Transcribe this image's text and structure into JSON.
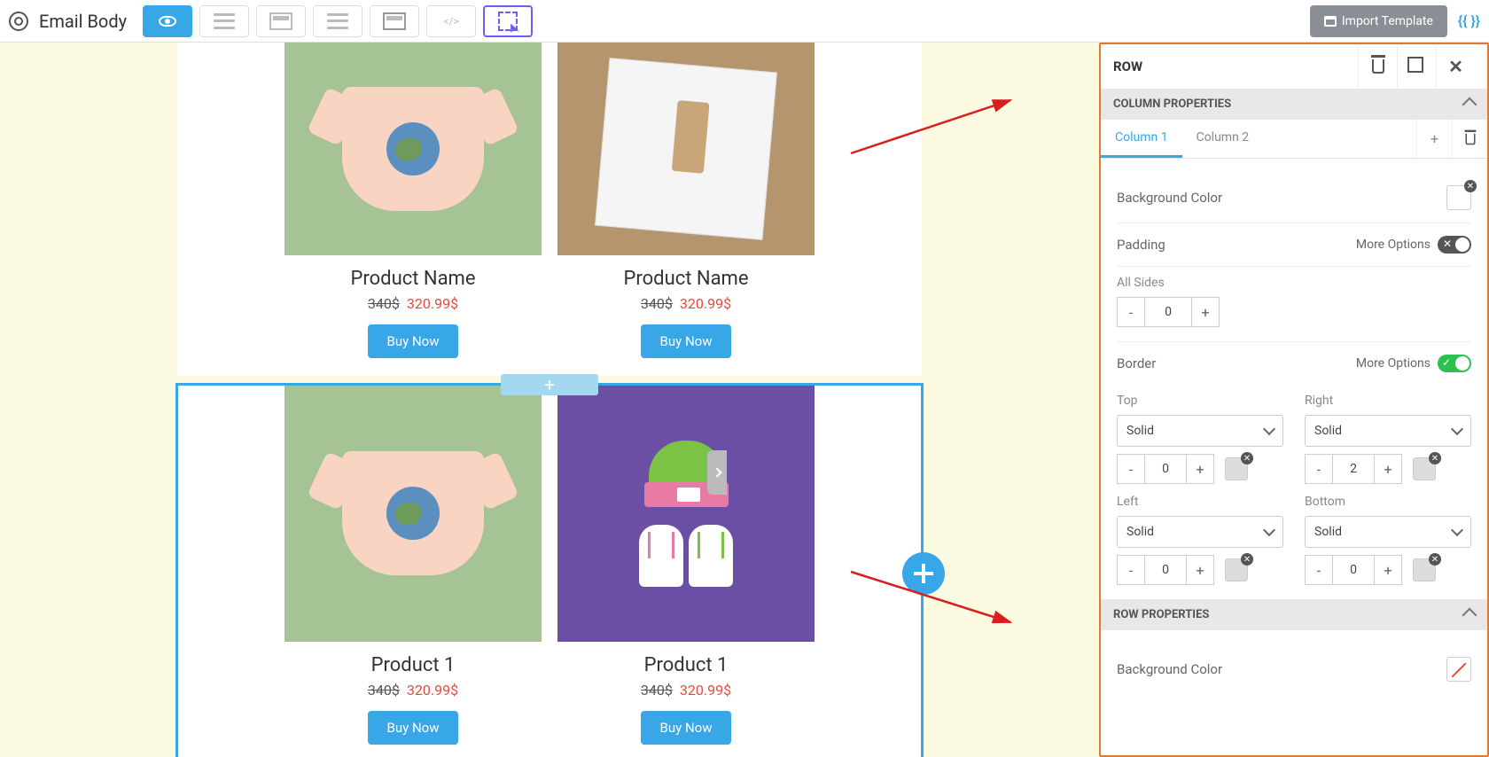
{
  "toolbar": {
    "title": "Email Body",
    "import_label": "Import Template",
    "braces": "{{ }}"
  },
  "products_top": [
    {
      "name": "Product Name",
      "old": "340$",
      "new": "320.99$",
      "buy": "Buy Now",
      "img": "green"
    },
    {
      "name": "Product Name",
      "old": "340$",
      "new": "320.99$",
      "buy": "Buy Now",
      "img": "brown"
    }
  ],
  "products_sel": [
    {
      "name": "Product 1",
      "old": "340$",
      "new": "320.99$",
      "buy": "Buy Now",
      "img": "green"
    },
    {
      "name": "Product 1",
      "old": "340$",
      "new": "320.99$",
      "buy": "Buy Now",
      "img": "purple"
    }
  ],
  "add_label": "+",
  "panel": {
    "title": "ROW",
    "col_props": "COLUMN PROPERTIES",
    "tabs": [
      "Column 1",
      "Column 2"
    ],
    "bg_color": "Background Color",
    "padding": "Padding",
    "more_opt": "More Options",
    "all_sides": "All Sides",
    "all_sides_val": "0",
    "border": "Border",
    "borders": {
      "top": {
        "label": "Top",
        "style": "Solid",
        "val": "0"
      },
      "right": {
        "label": "Right",
        "style": "Solid",
        "val": "2"
      },
      "left": {
        "label": "Left",
        "style": "Solid",
        "val": "0"
      },
      "bottom": {
        "label": "Bottom",
        "style": "Solid",
        "val": "0"
      }
    },
    "row_props": "ROW PROPERTIES",
    "row_bg": "Background Color"
  }
}
